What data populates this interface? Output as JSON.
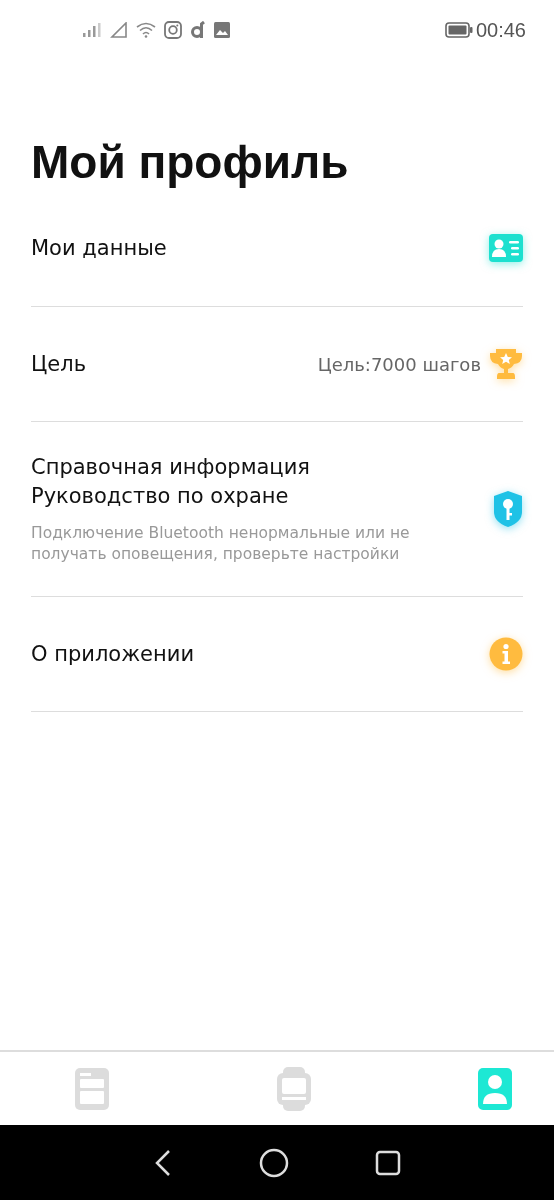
{
  "status_bar": {
    "time": "00:46"
  },
  "title": "Мой профиль",
  "items": [
    {
      "kind": "card",
      "label": "Мои данные"
    },
    {
      "kind": "trophy",
      "label": "Цель",
      "value": "Цель:7000 шагов"
    },
    {
      "kind": "shield",
      "label": "Справочная информация",
      "label_2": "Руководство по охране",
      "note": "Подключение Bluetooth ненормальные или не получать оповещения, проверьте настройки"
    },
    {
      "kind": "info",
      "label": "О приложении"
    }
  ],
  "tabs": [
    {
      "kind": "list",
      "selected": false
    },
    {
      "kind": "watch",
      "selected": false
    },
    {
      "kind": "profile",
      "selected": true
    }
  ]
}
